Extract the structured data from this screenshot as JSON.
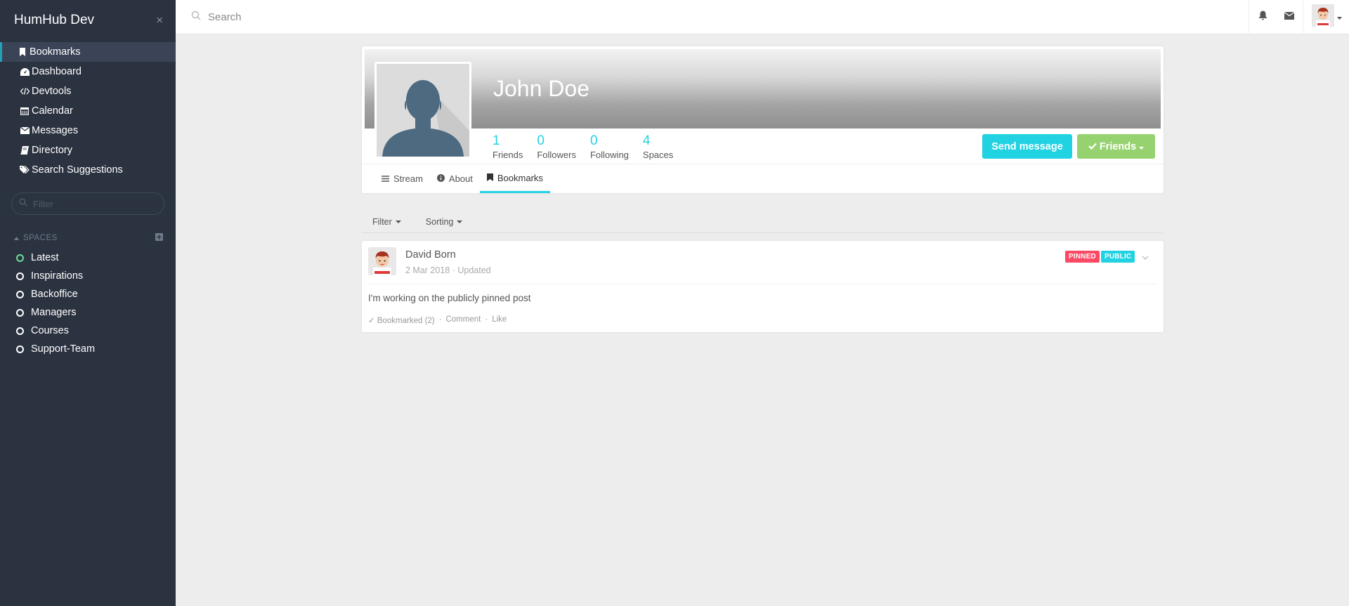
{
  "app": {
    "title": "HumHub Dev",
    "close_glyph": "×"
  },
  "sidebar": {
    "nav": [
      {
        "label": "Bookmarks",
        "icon": "bookmark-icon",
        "active": true
      },
      {
        "label": "Dashboard",
        "icon": "dashboard-icon"
      },
      {
        "label": "Devtools",
        "icon": "code-icon"
      },
      {
        "label": "Calendar",
        "icon": "calendar-icon"
      },
      {
        "label": "Messages",
        "icon": "envelope-icon"
      },
      {
        "label": "Directory",
        "icon": "book-icon"
      },
      {
        "label": "Search Suggestions",
        "icon": "tags-icon"
      }
    ],
    "filter_placeholder": "Filter",
    "spaces_label": "SPACES",
    "spaces": [
      {
        "label": "Latest",
        "active": true
      },
      {
        "label": "Inspirations"
      },
      {
        "label": "Backoffice"
      },
      {
        "label": "Managers"
      },
      {
        "label": "Courses"
      },
      {
        "label": "Support-Team"
      }
    ]
  },
  "topbar": {
    "search_placeholder": "Search"
  },
  "profile": {
    "name": "John Doe",
    "stats": [
      {
        "num": "1",
        "label": "Friends"
      },
      {
        "num": "0",
        "label": "Followers"
      },
      {
        "num": "0",
        "label": "Following"
      },
      {
        "num": "4",
        "label": "Spaces"
      }
    ],
    "send_message_label": "Send message",
    "friends_label": "Friends",
    "tabs": [
      {
        "label": "Stream",
        "icon": "list-icon"
      },
      {
        "label": "About",
        "icon": "info-icon"
      },
      {
        "label": "Bookmarks",
        "icon": "bookmark-icon",
        "active": true
      }
    ]
  },
  "filterbar": {
    "filter_label": "Filter",
    "sorting_label": "Sorting"
  },
  "post": {
    "author": "David Born",
    "meta": "2 Mar 2018 · Updated",
    "badge_pinned": "PINNED",
    "badge_public": "PUBLIC",
    "text": "I'm working on the publicly pinned post",
    "bookmarked": "✓ Bookmarked (2)",
    "dot": "·",
    "comment": "Comment",
    "like": "Like"
  },
  "colors": {
    "accent": "#21d2e2",
    "success": "#97d271",
    "danger": "#fc4a64",
    "sidebar_bg": "#2b3240"
  }
}
